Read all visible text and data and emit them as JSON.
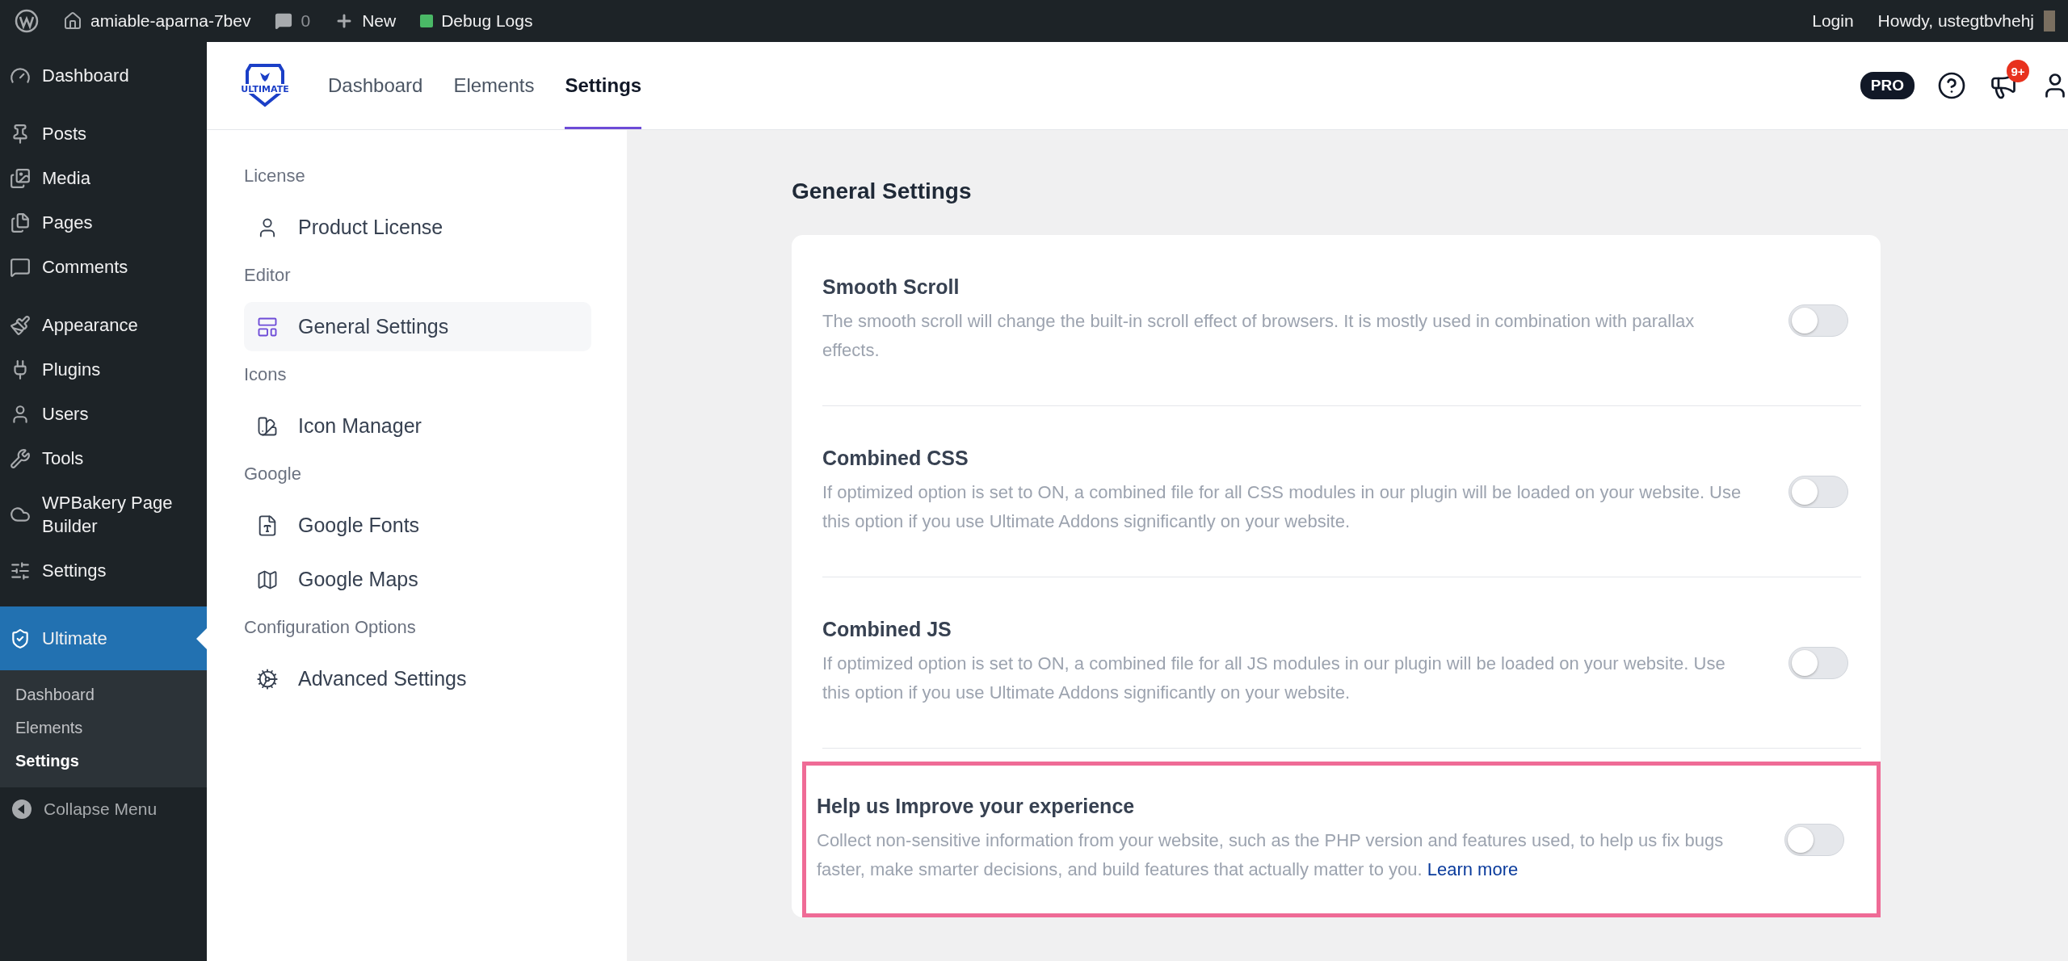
{
  "admin_bar": {
    "site": "amiable-aparna-7bev",
    "comments": "0",
    "new": "New",
    "debug": "Debug Logs",
    "login": "Login",
    "howdy": "Howdy, ustegtbvhehj"
  },
  "wp_menu": {
    "groups": [
      [
        {
          "label": "Dashboard",
          "selected": false
        }
      ],
      [
        {
          "label": "Posts",
          "selected": false
        },
        {
          "label": "Media",
          "selected": false
        },
        {
          "label": "Pages",
          "selected": false
        },
        {
          "label": "Comments",
          "selected": false
        }
      ],
      [
        {
          "label": "Appearance",
          "selected": false
        },
        {
          "label": "Plugins",
          "selected": false
        },
        {
          "label": "Users",
          "selected": false
        },
        {
          "label": "Tools",
          "selected": false
        },
        {
          "label": "WPBakery Page Builder",
          "selected": false
        },
        {
          "label": "Settings",
          "selected": false
        }
      ],
      [
        {
          "label": "Ultimate",
          "selected": true
        }
      ]
    ],
    "submenu": [
      {
        "label": "Dashboard",
        "selected": false
      },
      {
        "label": "Elements",
        "selected": false
      },
      {
        "label": "Settings",
        "selected": true
      }
    ],
    "collapse": "Collapse Menu"
  },
  "plugin_header": {
    "logo_text": "ULTIMATE",
    "tabs": [
      {
        "label": "Dashboard",
        "selected": false
      },
      {
        "label": "Elements",
        "selected": false
      },
      {
        "label": "Settings",
        "selected": true
      }
    ],
    "pro_badge": "PRO",
    "notification_count": "9+"
  },
  "settings_nav": [
    {
      "label": "License",
      "items": [
        {
          "label": "Product License",
          "selected": false
        }
      ]
    },
    {
      "label": "Editor",
      "items": [
        {
          "label": "General Settings",
          "selected": true
        }
      ]
    },
    {
      "label": "Icons",
      "items": [
        {
          "label": "Icon Manager",
          "selected": false
        }
      ]
    },
    {
      "label": "Google",
      "items": [
        {
          "label": "Google Fonts",
          "selected": false
        },
        {
          "label": "Google Maps",
          "selected": false
        }
      ]
    },
    {
      "label": "Configuration Options",
      "items": [
        {
          "label": "Advanced Settings",
          "selected": false
        }
      ]
    }
  ],
  "general_settings": {
    "title": "General Settings",
    "options": [
      {
        "title": "Smooth Scroll",
        "description": "The smooth scroll will change the built-in scroll effect of browsers. It is mostly used in combination with parallax effects.",
        "on": false,
        "highlighted": false
      },
      {
        "title": "Combined CSS",
        "description": "If optimized option is set to ON, a combined file for all CSS modules in our plugin will be loaded on your website. Use this option if you use Ultimate Addons significantly on your website.",
        "on": false,
        "highlighted": false
      },
      {
        "title": "Combined JS",
        "description": "If optimized option is set to ON, a combined file for all JS modules in our plugin will be loaded on your website. Use this option if you use Ultimate Addons significantly on your website.",
        "on": false,
        "highlighted": false
      },
      {
        "title": "Help us Improve your experience",
        "description": "Collect non-sensitive information from your website, such as the PHP version and features used, to help us fix bugs faster, make smarter decisions, and build features that actually matter to you.",
        "link": "Learn more",
        "on": false,
        "highlighted": true
      }
    ]
  }
}
